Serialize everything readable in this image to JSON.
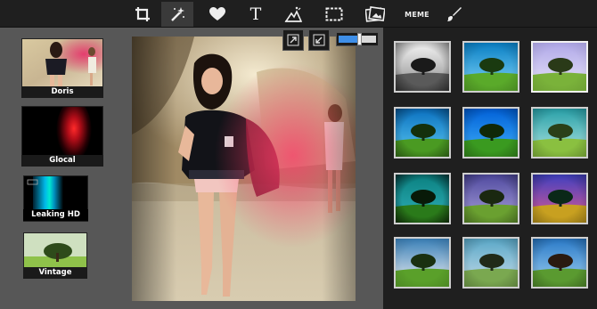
{
  "toolbar": {
    "tools": [
      {
        "id": "crop",
        "icon": "crop-icon"
      },
      {
        "id": "effects",
        "icon": "magic-wand-icon",
        "active": true
      },
      {
        "id": "stickers",
        "icon": "heart-icon"
      },
      {
        "id": "text",
        "icon": "text-icon",
        "label": "T"
      },
      {
        "id": "overlays",
        "icon": "overlay-icon"
      },
      {
        "id": "frames",
        "icon": "frame-icon"
      },
      {
        "id": "photo",
        "icon": "photo-icon"
      },
      {
        "id": "meme",
        "icon": "meme-icon",
        "label": "MEME"
      },
      {
        "id": "brush",
        "icon": "brush-icon"
      }
    ]
  },
  "effects": [
    {
      "name": "Doris"
    },
    {
      "name": "Glocal"
    },
    {
      "name": "Leaking HD"
    },
    {
      "name": "Vintage"
    }
  ],
  "canvas": {
    "zoom_slider_level": 0.55,
    "zoom_in_icon": "expand-icon",
    "zoom_out_icon": "shrink-icon"
  },
  "filters": {
    "count": 12,
    "selected_index": 2
  },
  "colors": {
    "toolbar_bg": "#1f1f1f",
    "panel_bg": "#575757",
    "accent": "#3f8fe8"
  }
}
